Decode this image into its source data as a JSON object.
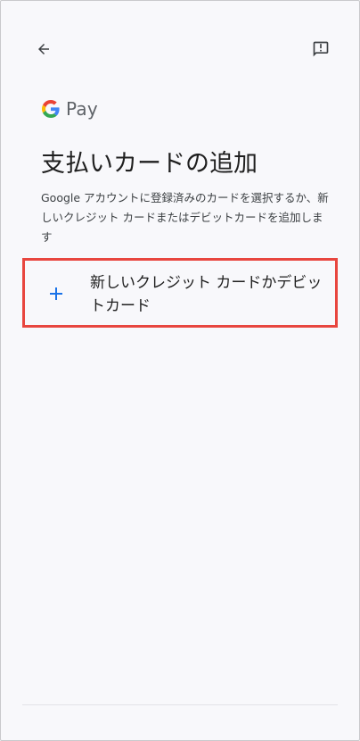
{
  "header": {
    "back_icon": "arrow-back-icon",
    "feedback_icon": "feedback-icon"
  },
  "brand": {
    "logo_text": "Pay",
    "g_colors": {
      "blue": "#4285F4",
      "red": "#EA4335",
      "yellow": "#FBBC05",
      "green": "#34A853"
    }
  },
  "page": {
    "title": "支払いカードの追加",
    "description": "Google アカウントに登録済みのカードを選択するか、新しいクレジット カードまたはデビットカードを追加します"
  },
  "add_card_option": {
    "icon": "plus-icon",
    "label": "新しいクレジット カードかデビットカード",
    "highlight_color": "#E8463F",
    "icon_color": "#1A73E8"
  }
}
